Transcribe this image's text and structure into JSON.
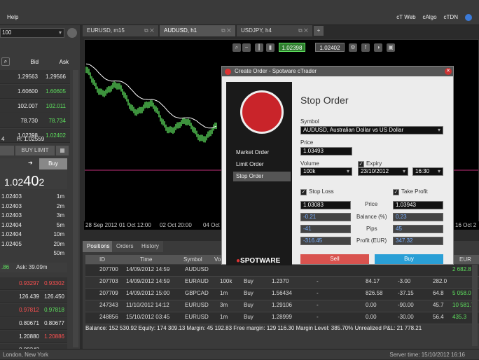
{
  "topbar": {
    "menu": "Help",
    "links": [
      "cT Web",
      "cAlgo",
      "cTDN"
    ]
  },
  "left": {
    "symbol_select": "100",
    "bid": "Bid",
    "ask": "Ask",
    "watchlist": [
      {
        "bid": "1.29563",
        "ask": "1.29566",
        "c": "w"
      },
      {
        "bid": "1.60600",
        "ask": "1.60605",
        "c": "g"
      },
      {
        "bid": "102.007",
        "ask": "102.011",
        "c": "g"
      },
      {
        "bid": "78.730",
        "ask": "78.734",
        "c": "g"
      },
      {
        "bid": "1.02398",
        "ask": "1.02402",
        "c": "g"
      }
    ],
    "hilo": "H: 1.02559",
    "lo": "4",
    "buy_limit": "BUY LIMIT",
    "buy": "Buy",
    "big_pre": "1.02",
    "big_main": "40",
    "big_post": "2",
    "depth": [
      {
        "p": "1.02403",
        "t": "1m"
      },
      {
        "p": "1.02403",
        "t": "2m"
      },
      {
        "p": "1.02403",
        "t": "3m"
      },
      {
        "p": "1.02404",
        "t": "5m"
      },
      {
        "p": "1.02404",
        "t": "10m"
      },
      {
        "p": "1.02405",
        "t": "20m"
      },
      {
        "p": "",
        "t": "50m"
      }
    ],
    "ask_depth": "Ask: 39.09m",
    "ask_pre": ".86",
    "bottom_list": [
      {
        "bid": "0.93297",
        "ask": "0.93302",
        "c": "r"
      },
      {
        "bid": "126.439",
        "ask": "126.450",
        "c": "w"
      },
      {
        "bid": "0.97812",
        "ask": "0.97818",
        "c": "rg"
      },
      {
        "bid": "0.80671",
        "ask": "0.80677",
        "c": "w"
      },
      {
        "bid": "1.20880",
        "ask": "1.20886",
        "c": "wr"
      },
      {
        "bid": "0.89343",
        "ask": "",
        "c": "w"
      }
    ]
  },
  "tabs": [
    {
      "label": "EURUSD, m15"
    },
    {
      "label": "AUDUSD, h1"
    },
    {
      "label": "USDJPY, h4"
    }
  ],
  "chart": {
    "bid_btn": "1.02398",
    "ask_btn": "1.02402",
    "xlabels": [
      "28 Sep 2012",
      "01 Oct 12:00",
      "02 Oct 20:00",
      "04 Oct",
      "16 Oct 2"
    ]
  },
  "dialog": {
    "title": "Create Order - Spotware cTrader",
    "menu": [
      "Market Order",
      "Limit Order",
      "Stop Order"
    ],
    "heading": "Stop Order",
    "symbol_label": "Symbol",
    "symbol_value": "AUDUSD, Australian Dollar vs US Dollar",
    "price_label": "Price",
    "price_value": "1.03493",
    "volume_label": "Volume",
    "volume_value": "100k",
    "expiry_label": "Expiry",
    "expiry_date": "23/10/2012",
    "expiry_time": "16:30",
    "stop_loss_label": "Stop Loss",
    "take_profit_label": "Take Profit",
    "sl_price": "1.03083",
    "tp_price": "1.03943",
    "sl_balance": "-0.21",
    "tp_balance": "0.23",
    "sl_pips": "-41",
    "tp_pips": "45",
    "sl_profit": "-316.45",
    "tp_profit": "347.32",
    "price_col": "Price",
    "balance_col": "Balance (%)",
    "pips_col": "Pips",
    "profit_col": "Profit (EUR)",
    "sell": "Sell",
    "buy": "Buy",
    "brand": "SPOTWARE"
  },
  "bottom": {
    "tabs": [
      "Positions",
      "Orders",
      "History"
    ],
    "columns": [
      "ID",
      "Time",
      "Symbol",
      "Vo",
      "EUR"
    ],
    "rows": [
      {
        "id": "207700",
        "time": "14/09/2012 14:59",
        "sym": "AUDUSD",
        "vol": "",
        "dir": "",
        "price": "",
        "a": "",
        "b": "",
        "c": "",
        "d": "",
        "eur": "2 682.8",
        "ec": "g"
      },
      {
        "id": "207703",
        "time": "14/09/2012 14:59",
        "sym": "EURAUD",
        "vol": "100k",
        "dir": "Buy",
        "price": "1.2370",
        "a": "-",
        "b": "84.17",
        "c": "-3.00",
        "d": "282.0",
        "eur": "",
        "ec": "w"
      },
      {
        "id": "207709",
        "time": "14/09/2012 15:00",
        "sym": "GBPCAD",
        "vol": "1m",
        "dir": "Buy",
        "price": "1.56434",
        "a": "-",
        "b": "826.58",
        "c": "-37.15",
        "d": "64.8",
        "eur": "5 058.0",
        "ec": "g"
      },
      {
        "id": "247343",
        "time": "11/10/2012 14:12",
        "sym": "EURUSD",
        "vol": "3m",
        "dir": "Buy",
        "price": "1.29106",
        "a": "-",
        "b": "0.00",
        "c": "-90.00",
        "d": "45.7",
        "eur": "10 581.7",
        "ec": "g"
      },
      {
        "id": "248856",
        "time": "15/10/2012 03:45",
        "sym": "EURUSD",
        "vol": "1m",
        "dir": "Buy",
        "price": "1.28999",
        "a": "-",
        "b": "0.00",
        "c": "-30.00",
        "d": "56.4",
        "eur": "435.3",
        "ec": "g"
      }
    ],
    "totals": "Balance: 152 530.92   Equity: 174 309.13   Margin: 45 192.83   Free margin: 129 116.30   Margin Level: 385.70%   Unrealized P&L: 21 778.21"
  },
  "status": {
    "left": "London, New York",
    "right": "Server time: 15/10/2012 16:16"
  }
}
